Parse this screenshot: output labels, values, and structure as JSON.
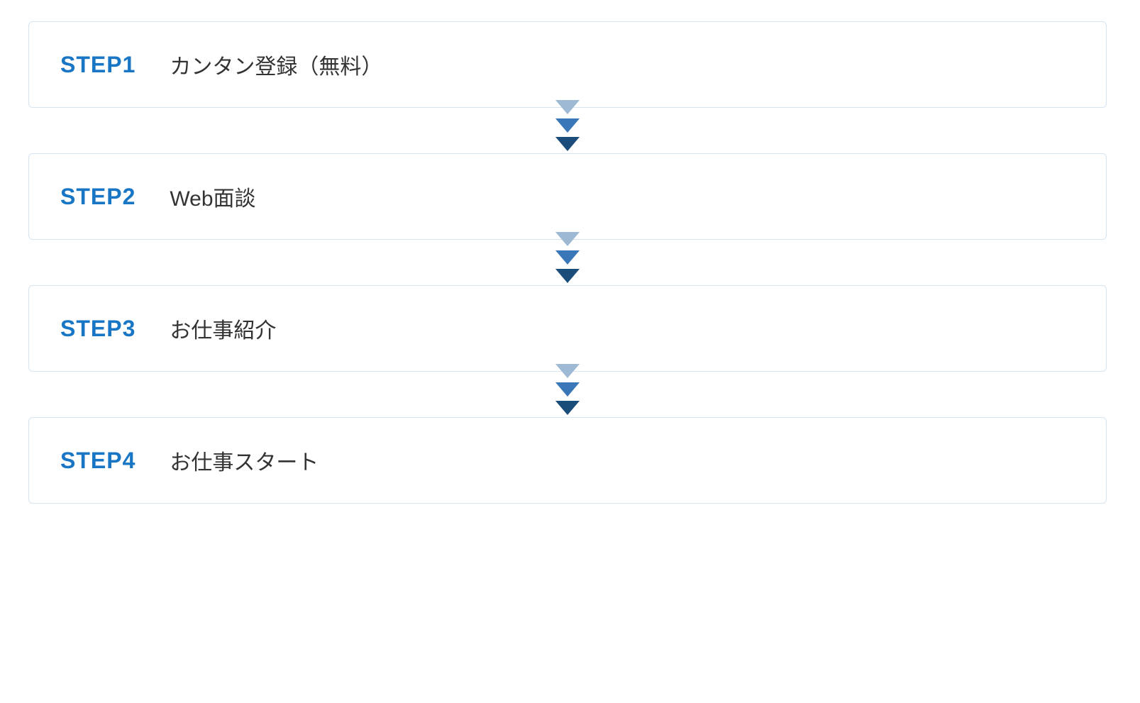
{
  "steps": [
    {
      "label": "STEP1",
      "text": "カンタン登録（無料）"
    },
    {
      "label": "STEP2",
      "text": "Web面談"
    },
    {
      "label": "STEP3",
      "text": "お仕事紹介"
    },
    {
      "label": "STEP4",
      "text": "お仕事スタート"
    }
  ]
}
